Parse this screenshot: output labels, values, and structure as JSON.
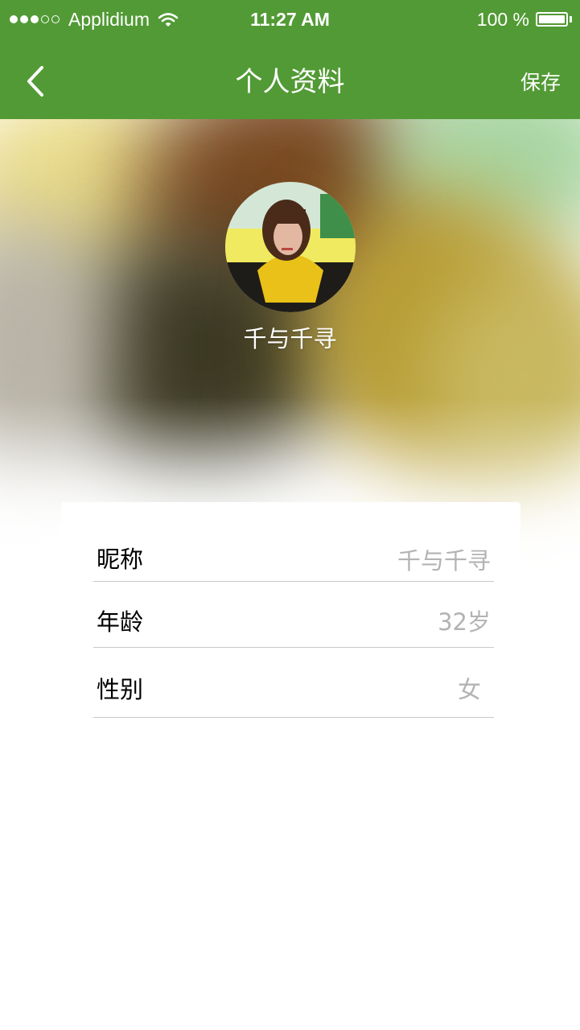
{
  "status_bar": {
    "carrier": "Applidium",
    "time": "11:27 AM",
    "battery": "100 %",
    "signal_strength": "3 of 5"
  },
  "nav": {
    "back_icon": "chevron-left-icon",
    "title": "个人资料",
    "save_label": "保存"
  },
  "profile": {
    "name": "千与千寻"
  },
  "fields": [
    {
      "label": "昵称",
      "value": "千与千寻"
    },
    {
      "label": "年龄",
      "value": "32岁"
    },
    {
      "label": "性别",
      "value": "女"
    }
  ],
  "colors": {
    "accent": "#529a35",
    "value_gray": "#b3b3b3",
    "divider": "#c9c9c9"
  }
}
